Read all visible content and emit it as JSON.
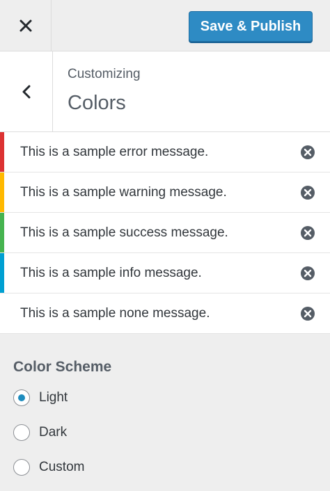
{
  "toolbar": {
    "close_icon": "close-icon",
    "publish_label": "Save & Publish",
    "publish_color": "#2e8bc4"
  },
  "header": {
    "back_icon": "chevron-left-icon",
    "eyebrow": "Customizing",
    "title": "Colors"
  },
  "notices": [
    {
      "text": "This is a sample error message.",
      "type": "error",
      "color": "#dc3232"
    },
    {
      "text": "This is a sample warning message.",
      "type": "warning",
      "color": "#ffb900"
    },
    {
      "text": "This is a sample success message.",
      "type": "success",
      "color": "#46b450"
    },
    {
      "text": "This is a sample info message.",
      "type": "info",
      "color": "#00a0d2"
    },
    {
      "text": "This is a sample none message.",
      "type": "none",
      "color": ""
    }
  ],
  "color_scheme": {
    "title": "Color Scheme",
    "options": [
      {
        "label": "Light",
        "selected": true
      },
      {
        "label": "Dark",
        "selected": false
      },
      {
        "label": "Custom",
        "selected": false
      }
    ]
  }
}
